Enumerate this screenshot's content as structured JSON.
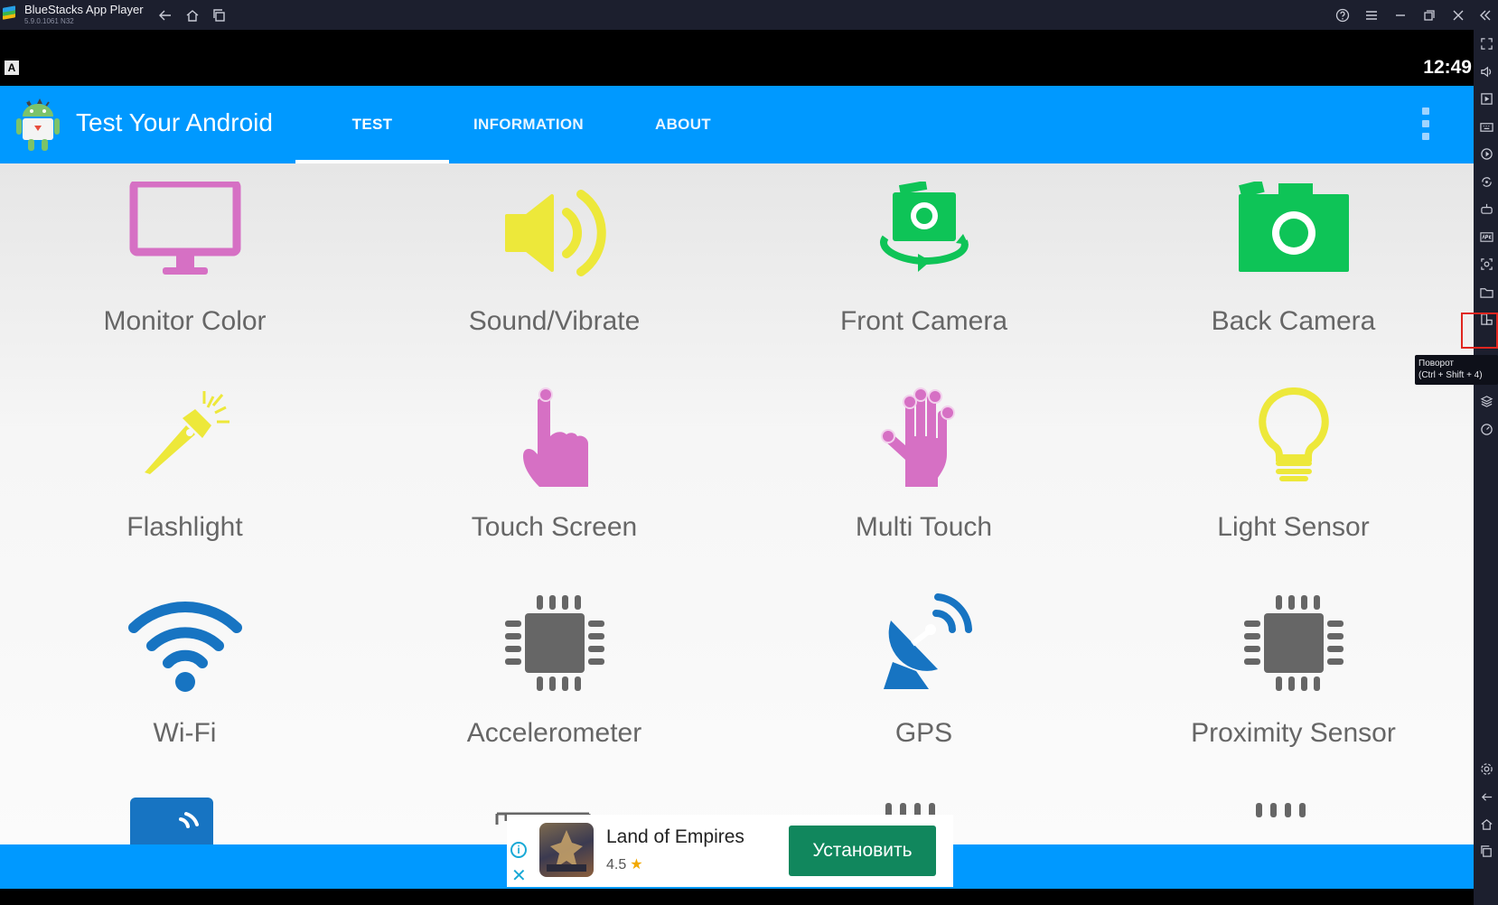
{
  "window": {
    "app_name": "BlueStacks App Player",
    "version": "5.9.0.1061 N32"
  },
  "statusbar": {
    "badge": "A",
    "time": "12:49"
  },
  "appbar": {
    "title": "Test Your Android",
    "tabs": [
      {
        "label": "TEST",
        "active": true
      },
      {
        "label": "INFORMATION",
        "active": false
      },
      {
        "label": "ABOUT",
        "active": false
      }
    ]
  },
  "tiles": [
    {
      "label": "Monitor Color",
      "icon": "monitor-icon",
      "color": "#d670c4"
    },
    {
      "label": "Sound/Vibrate",
      "icon": "speaker-icon",
      "color": "#ede83a"
    },
    {
      "label": "Front Camera",
      "icon": "camera-rotate-icon",
      "color": "#0ec457"
    },
    {
      "label": "Back Camera",
      "icon": "camera-icon",
      "color": "#0ec457"
    },
    {
      "label": "Flashlight",
      "icon": "flashlight-icon",
      "color": "#ede83a"
    },
    {
      "label": "Touch Screen",
      "icon": "finger-icon",
      "color": "#d670c4"
    },
    {
      "label": "Multi Touch",
      "icon": "hand-icon",
      "color": "#d670c4"
    },
    {
      "label": "Light Sensor",
      "icon": "lightbulb-icon",
      "color": "#ede83a"
    },
    {
      "label": "Wi-Fi",
      "icon": "wifi-icon",
      "color": "#1774c2"
    },
    {
      "label": "Accelerometer",
      "icon": "chip-icon",
      "color": "#666666"
    },
    {
      "label": "GPS",
      "icon": "satellite-dish-icon",
      "color": "#1774c2"
    },
    {
      "label": "Proximity Sensor",
      "icon": "chip-icon",
      "color": "#666666"
    }
  ],
  "ad": {
    "title": "Land of Empires",
    "rating": "4.5",
    "install_label": "Установить"
  },
  "tooltip": {
    "line1": "Поворот",
    "line2": "(Ctrl + Shift + 4)"
  },
  "colors": {
    "primary": "#0099ff",
    "titlebar": "#1c1f2e",
    "install": "#11875d"
  }
}
